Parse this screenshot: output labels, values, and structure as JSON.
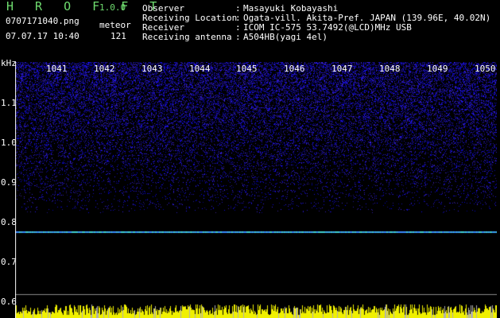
{
  "header": {
    "app_title": "H R O F F T",
    "version": "1.0.0",
    "file_name": "0707171040.png",
    "datetime": "07.07.17 10:40",
    "count_label": "meteor",
    "count_value": "121",
    "info": [
      {
        "label": "Observer",
        "sep": ":",
        "value": "Masayuki Kobayashi"
      },
      {
        "label": "Receiving Location",
        "sep": ":",
        "value": "Ogata-vill. Akita-Pref. JAPAN (139.96E, 40.02N)"
      },
      {
        "label": "Receiver",
        "sep": ":",
        "value": "ICOM IC-575 53.7492(@LCD)MHz USB"
      },
      {
        "label": "Receiving antenna",
        "sep": ":",
        "value": "A504HB(yagi 4el)"
      }
    ]
  },
  "spectrogram": {
    "y_unit": "kHz",
    "y_ticks": [
      "1.1",
      "1.0",
      "0.9",
      "0.8",
      "0.7",
      "0.6"
    ],
    "x_ticks": [
      "1041",
      "1042",
      "1043",
      "1044",
      "1045",
      "1046",
      "1047",
      "1048",
      "1049",
      "1050"
    ],
    "colors": {
      "noise": "#2828c8",
      "carrier": "#40d0d0",
      "bars": "#f0f000",
      "axis": "#ffffff"
    }
  }
}
